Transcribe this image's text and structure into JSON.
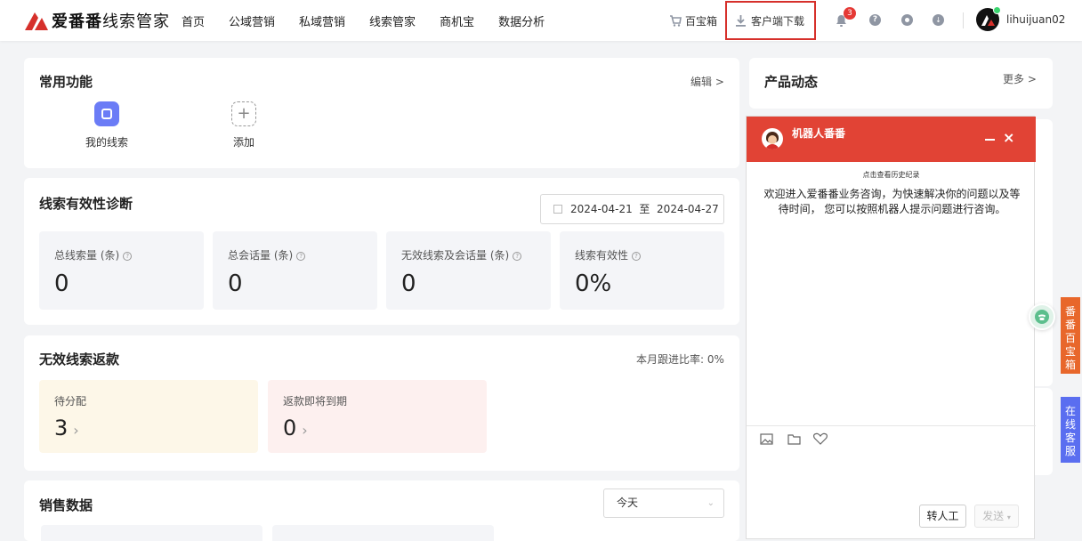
{
  "header": {
    "logo_brand": "爱番番",
    "logo_product": "线索管家",
    "nav": [
      "首页",
      "公域营销",
      "私域营销",
      "线索管家",
      "商机宝",
      "数据分析"
    ],
    "baibao": "百宝箱",
    "download": "客户端下载",
    "notification_count": "3",
    "username": "lihuijuan02"
  },
  "common": {
    "title": "常用功能",
    "edit": "编辑 >",
    "items": [
      "我的线索",
      "添加"
    ]
  },
  "diagnosis": {
    "title": "线索有效性诊断",
    "date_from": "2024-04-21",
    "date_sep": "至",
    "date_to": "2024-04-27",
    "stats": [
      {
        "label": "总线索量 (条)",
        "value": "0"
      },
      {
        "label": "总会话量 (条)",
        "value": "0"
      },
      {
        "label": "无效线索及会话量 (条)",
        "value": "0"
      },
      {
        "label": "线索有效性",
        "value": "0%"
      }
    ]
  },
  "refund": {
    "title": "无效线索返款",
    "ratio": "本月跟进比率: 0%",
    "pending_label": "待分配",
    "pending_value": "3",
    "expiring_label": "返款即将到期",
    "expiring_value": "0"
  },
  "sales": {
    "title": "销售数据",
    "period": "今天"
  },
  "product": {
    "title": "产品动态",
    "more": "更多 >"
  },
  "chat": {
    "bot_name": "机器人番番",
    "history": "点击查看历史纪录",
    "welcome": "欢迎进入爱番番业务咨询，为快速解决你的问题以及等待时间， 您可以按照机器人提示问题进行咨询。",
    "transfer": "转人工",
    "send": "发送"
  },
  "side": {
    "baibao_tab": "番番百宝箱",
    "service_tab": "在线客服"
  },
  "colors": {
    "accent": "#e14335",
    "primary": "#3b82f6",
    "icon_purple": "#6b7cf6"
  }
}
